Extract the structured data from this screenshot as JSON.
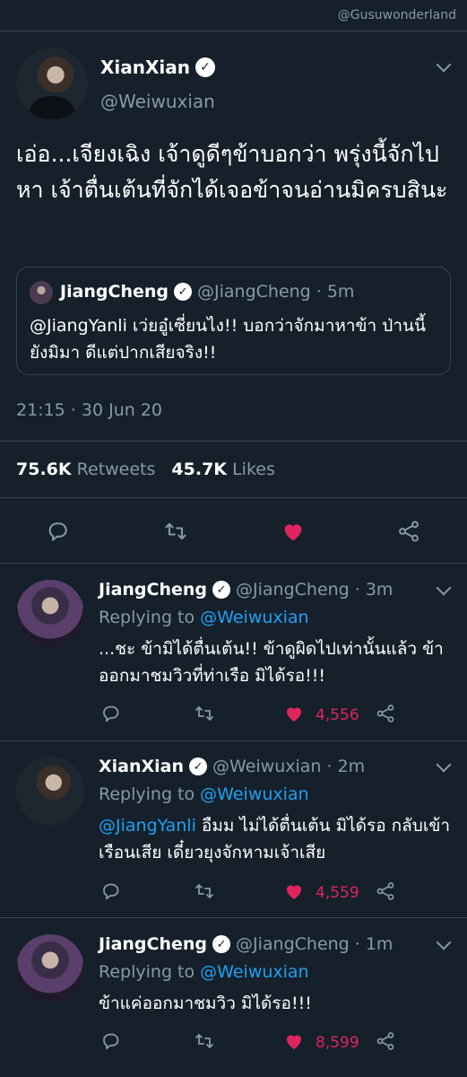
{
  "watermark": "@Gusuwonderland",
  "main_tweet": {
    "name": "XianXian",
    "handle": "@Weiwuxian",
    "text": "เอ่อ...เจียงเฉิง เจ้าดูดีๆข้าบอกว่า พรุ่งนี้จักไปหา เจ้าตื่นเต้นที่จักได้เจอข้าจนอ่านมิครบสินะ",
    "quote": {
      "name": "JiangCheng",
      "handle": "@JiangCheng",
      "time": "· 5m",
      "text": "@JiangYanli เว่ยอู๋เซี่ยนไง!! บอกว่าจักมาหาข้า ป่านนี้ยังมิมา ดีแต่ปากเสียจริง!!"
    },
    "timestamp": "21:15 · 30 Jun 20",
    "retweets_count": "75.6K",
    "retweets_label": "Retweets",
    "likes_count": "45.7K",
    "likes_label": "Likes"
  },
  "replies": [
    {
      "name": "JiangCheng",
      "handle": "@JiangCheng",
      "time": "· 3m",
      "replying_label": "Replying to",
      "replying_to": "@Weiwuxian",
      "mention": "",
      "text": "...ชะ ข้ามิได้ตื่นเต้น!! ข้าดูผิดไปเท่านั้นแล้ว ข้าออกมาชมวิวที่ท่าเรือ มิได้รอ!!!",
      "likes": "4,556"
    },
    {
      "name": "XianXian",
      "handle": "@Weiwuxian",
      "time": "· 2m",
      "replying_label": "Replying to",
      "replying_to": "@Weiwuxian",
      "mention": "@JiangYanli",
      "text": " อืมม ไม่ได้ตื่นเต้น มิได้รอ กลับเข้าเรือนเสีย เดี๋ยวยุงจักหามเจ้าเสีย",
      "likes": "4,559"
    },
    {
      "name": "JiangCheng",
      "handle": "@JiangCheng",
      "time": "· 1m",
      "replying_label": "Replying to",
      "replying_to": "@Weiwuxian",
      "mention": "",
      "text": "ข้าแค่ออกมาชมวิว มิได้รอ!!!",
      "likes": "8,599"
    }
  ],
  "colors": {
    "background": "#15202b",
    "secondary_text": "#8899a6",
    "link": "#1da1f2",
    "like": "#e0245e",
    "divider": "#38444d"
  }
}
